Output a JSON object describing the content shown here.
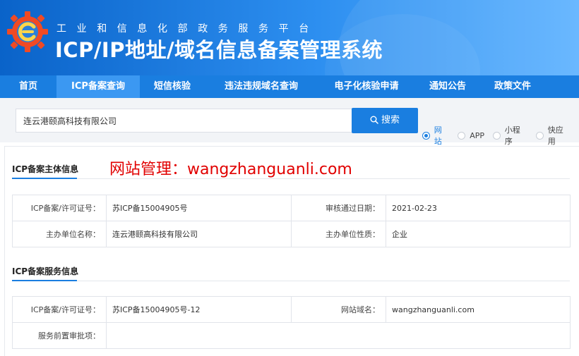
{
  "header": {
    "org_name": "工业和信息化部政务服务平台",
    "system_title": "ICP/IP地址/域名信息备案管理系统"
  },
  "nav": {
    "items": [
      {
        "label": "首页",
        "width": 80,
        "active": false
      },
      {
        "label": "ICP备案查询",
        "width": 118,
        "active": true
      },
      {
        "label": "短信核验",
        "width": 92,
        "active": false
      },
      {
        "label": "违法违规域名查询",
        "width": 160,
        "active": false
      },
      {
        "label": "电子化核验申请",
        "width": 138,
        "active": false
      },
      {
        "label": "通知公告",
        "width": 92,
        "active": false
      },
      {
        "label": "政策文件",
        "width": 92,
        "active": false
      }
    ]
  },
  "search": {
    "value": "连云港颐高科技有限公司",
    "button_label": "搜索",
    "options": [
      {
        "label": "网站",
        "checked": true
      },
      {
        "label": "APP",
        "checked": false
      },
      {
        "label": "小程序",
        "checked": false
      },
      {
        "label": "快应用",
        "checked": false
      }
    ]
  },
  "watermark": "网站管理：wangzhanguanli.com",
  "subject_section": {
    "title": "ICP备案主体信息",
    "rows": [
      {
        "label1": "ICP备案/许可证号：",
        "value1": "苏ICP备15004905号",
        "label2": "审核通过日期：",
        "value2": "2021-02-23"
      },
      {
        "label1": "主办单位名称：",
        "value1": "连云港颐高科技有限公司",
        "label2": "主办单位性质：",
        "value2": "企业"
      }
    ]
  },
  "service_section": {
    "title": "ICP备案服务信息",
    "rows": [
      {
        "label1": "ICP备案/许可证号：",
        "value1": "苏ICP备15004905号-12",
        "label2": "网站域名：",
        "value2": "wangzhanguanli.com"
      },
      {
        "label1": "服务前置审批项：",
        "value1": "",
        "label2": "",
        "value2": ""
      }
    ]
  },
  "colors": {
    "primary": "#1a7ee0",
    "watermark": "#e10000"
  }
}
